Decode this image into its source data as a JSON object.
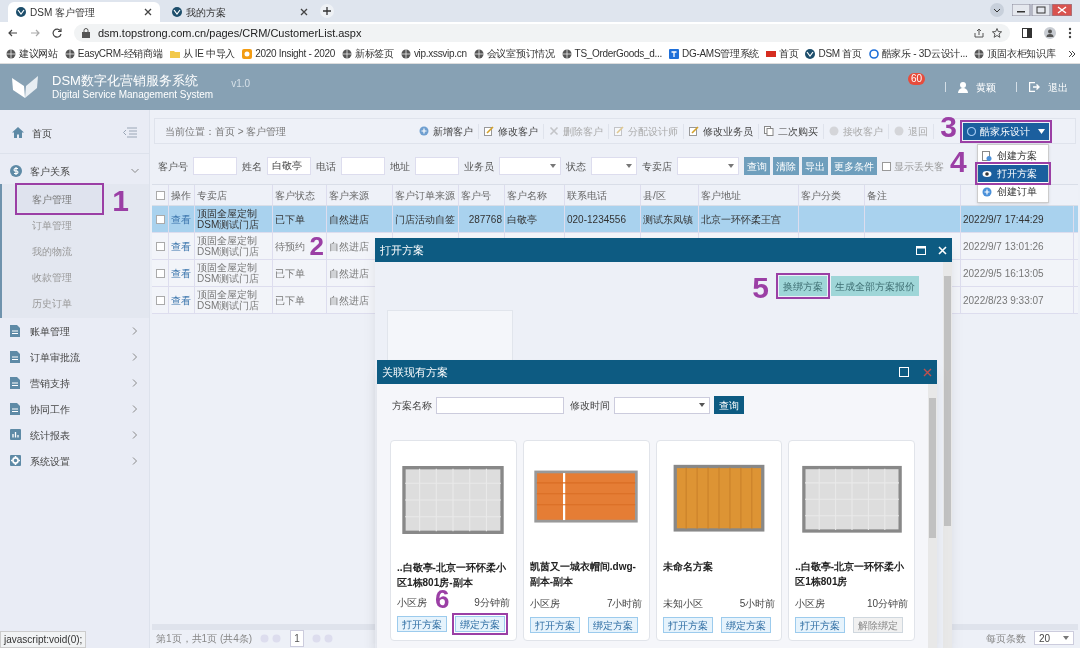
{
  "browser": {
    "tabs": [
      {
        "label": "DSM 客户管理",
        "selected": true
      },
      {
        "label": "我的方案",
        "selected": false
      }
    ],
    "url": "dsm.topstrong.com.cn/pages/CRM/CustomerList.aspx",
    "bookmarks": [
      {
        "label": "建议网站",
        "kind": "globe"
      },
      {
        "label": "EasyCRM-经销商端",
        "kind": "globe"
      },
      {
        "label": "从 IE 中导入",
        "kind": "folder"
      },
      {
        "label": "2020 Insight - 2020",
        "kind": "orange"
      },
      {
        "label": "新标签页",
        "kind": "globe"
      },
      {
        "label": "vip.xssvip.cn",
        "kind": "globe"
      },
      {
        "label": "会议室预订情况",
        "kind": "globe"
      },
      {
        "label": "TS_OrderGoods_d...",
        "kind": "globe"
      },
      {
        "label": "DG-AMS管理系统",
        "kind": "blue"
      },
      {
        "label": "首页",
        "kind": "red"
      },
      {
        "label": "DSM 首页",
        "kind": "dsm"
      },
      {
        "label": "酷家乐 - 3D云设计...",
        "kind": "ring"
      },
      {
        "label": "顶固衣柜知识库",
        "kind": "globe"
      }
    ],
    "status_text": "javascript:void(0);"
  },
  "header": {
    "title": "DSM数字化营销服务系统",
    "subtitle": "Digital Service Management System",
    "version": "v1.0",
    "badge": "60",
    "user": "黄颖",
    "logout": "退出"
  },
  "sidebar": {
    "items": [
      {
        "label": "首页"
      },
      {
        "label": "客户关系",
        "expanded": true,
        "children": [
          {
            "label": "客户管理",
            "selected": true,
            "marker": {
              "label": "1"
            }
          },
          {
            "label": "订单管理",
            "selected": false
          },
          {
            "label": "我的物流",
            "selected": false
          },
          {
            "label": "收款管理",
            "selected": false
          },
          {
            "label": "历史订单",
            "selected": false
          }
        ]
      },
      {
        "label": "账单管理",
        "expanded": false
      },
      {
        "label": "订单审批流",
        "expanded": false
      },
      {
        "label": "营销支持",
        "expanded": false
      },
      {
        "label": "协同工作",
        "expanded": false
      },
      {
        "label": "统计报表",
        "expanded": false
      },
      {
        "label": "系统设置",
        "expanded": false
      }
    ]
  },
  "breadcrumb": "当前位置：首页 > 客户管理",
  "toolbar": [
    {
      "label": "新增客户",
      "disabled": false
    },
    {
      "label": "修改客户",
      "disabled": false
    },
    {
      "label": "删除客户",
      "disabled": true
    },
    {
      "label": "分配设计师",
      "disabled": true
    },
    {
      "label": "修改业务员",
      "disabled": false
    },
    {
      "label": "二次购买",
      "disabled": false
    },
    {
      "label": "接收客户",
      "disabled": true
    },
    {
      "label": "退回",
      "disabled": true
    }
  ],
  "design_button": {
    "label": "酷家乐设计",
    "marker": {
      "label": "3"
    },
    "menu": [
      {
        "label": "创建方案",
        "selected": false
      },
      {
        "label": "打开方案",
        "selected": true,
        "marker": {
          "label": "4"
        }
      },
      {
        "label": "创建订单",
        "selected": false
      }
    ]
  },
  "filters": [
    {
      "label": "客户号",
      "kind": "text"
    },
    {
      "label": "姓名",
      "kind": "text",
      "value": "白敬亭"
    },
    {
      "label": "电话",
      "kind": "text"
    },
    {
      "label": "地址",
      "kind": "text"
    },
    {
      "label": "业务员",
      "kind": "select"
    },
    {
      "label": "状态",
      "kind": "select"
    },
    {
      "label": "专卖店",
      "kind": "select"
    }
  ],
  "filter_buttons": [
    "查询",
    "清除",
    "导出",
    "更多条件"
  ],
  "show_lost": {
    "label": "显示丢失客",
    "checked": false
  },
  "table": {
    "all_checked": false,
    "columns": [
      "操作",
      "专卖店",
      "客户状态",
      "客户来源",
      "客户订单来源",
      "客户号",
      "客户名称",
      "联系电话",
      "县/区",
      "客户地址",
      "客户分类",
      "备注"
    ],
    "rows": [
      {
        "selected": true,
        "checked": false,
        "cells": [
          "查看",
          "顶固全屋定制DSM测试门店",
          "已下单",
          "自然进店",
          "门店活动自签",
          "287768",
          "白敬亭",
          "020-1234556",
          "测试东凤镇",
          "北京一环怀柔王宫",
          null,
          null,
          "2022/9/7 17:44:29"
        ]
      },
      {
        "selected": false,
        "checked": false,
        "marker": {
          "label": "2"
        },
        "cells": [
          "查看",
          "顶固全屋定制DSM测试门店",
          "待预约",
          "自然进店",
          null,
          null,
          null,
          null,
          null,
          null,
          null,
          null,
          "2022/9/7 13:01:26"
        ]
      },
      {
        "selected": false,
        "checked": false,
        "cells": [
          "查看",
          "顶固全屋定制DSM测试门店",
          "已下单",
          "自然进店",
          null,
          null,
          null,
          null,
          null,
          null,
          null,
          null,
          "2022/9/5 16:13:05"
        ]
      },
      {
        "selected": false,
        "checked": false,
        "cells": [
          "查看",
          "顶固全屋定制DSM测试门店",
          "已下单",
          "自然进店",
          null,
          null,
          null,
          null,
          null,
          null,
          null,
          null,
          "2022/8/23 9:33:07"
        ]
      }
    ]
  },
  "pagination": {
    "summary": "第1页，共1页 (共4条)",
    "page": "1",
    "page_size_label": "每页条数",
    "page_size": "20"
  },
  "open_dialog": {
    "title": "打开方案",
    "buttons": [
      {
        "label": "换绑方案",
        "marker": {
          "label": "5"
        }
      },
      {
        "label": "生成全部方案报价"
      }
    ]
  },
  "link_dialog": {
    "title": "关联现有方案",
    "search": [
      {
        "label": "方案名称",
        "kind": "text"
      },
      {
        "label": "修改时间",
        "kind": "select"
      }
    ],
    "search_button": "查询",
    "cards": [
      {
        "title": "..白敬亭-北京一环怀柔小区1栋801房-副本",
        "community": "小区房",
        "time": "9分钟前",
        "buttons": [
          {
            "label": "打开方案",
            "kind": "open"
          },
          {
            "label": "绑定方案",
            "kind": "bind",
            "marker": {
              "label": "6"
            }
          }
        ]
      },
      {
        "title": "凯茵又一城衣帽间.dwg-副本-副本",
        "community": "小区房",
        "time": "7小时前",
        "buttons": [
          {
            "label": "打开方案",
            "kind": "open"
          },
          {
            "label": "绑定方案",
            "kind": "bind"
          }
        ]
      },
      {
        "title": "未命名方案",
        "community": "未知小区",
        "time": "5小时前",
        "buttons": [
          {
            "label": "打开方案",
            "kind": "open"
          },
          {
            "label": "绑定方案",
            "kind": "bind"
          }
        ]
      },
      {
        "title": "..白敬亭-北京一环怀柔小区1栋801房",
        "community": "小区房",
        "time": "10分钟前",
        "buttons": [
          {
            "label": "打开方案",
            "kind": "open"
          },
          {
            "label": "解除绑定",
            "kind": "unbind"
          }
        ]
      }
    ]
  }
}
